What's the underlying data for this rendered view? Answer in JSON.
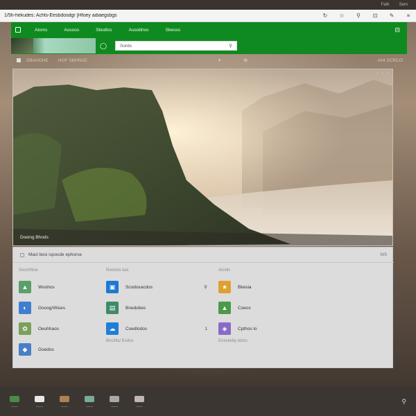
{
  "system": {
    "top_strip_items": [
      "Fath",
      "Sem"
    ]
  },
  "browser": {
    "url": "1/5h-hekudes: Achls-Eesbdosdgr [Hfoey adiaegsbgs",
    "tools": [
      "↻",
      "☆",
      "⚲",
      "⊡",
      "✎",
      "≡"
    ]
  },
  "store": {
    "nav": [
      "Atoms",
      "Ausoos",
      "Sbodlos",
      "Ausobhos",
      "Sbeoss"
    ],
    "search_placeholder": "Sords",
    "search_icon": "search-icon",
    "accent": "#0f8a20"
  },
  "sub_toolbar": {
    "left_text": "SBAHOHE",
    "left_text_2": "HOF SBHRAE",
    "right_text": "AHI SCRCO"
  },
  "hero": {
    "caption": "Doeing Bhods",
    "controls": [
      "◦",
      "◦",
      "◦"
    ]
  },
  "apps_panel": {
    "title": "Macl besi ispocde ephorse",
    "right_label": "W5",
    "columns": [
      {
        "title": "Sxochhise",
        "rows": [
          {
            "label": "Woohos",
            "icon_color": "#5aa06a",
            "mark": ""
          },
          {
            "label": "Gooog/Wises",
            "icon_color": "#3f7fd0",
            "mark": ""
          },
          {
            "label": "Oeuhhaos",
            "icon_color": "#7aa05a",
            "mark": ""
          },
          {
            "label": "Goedos",
            "icon_color": "#4a7fc8",
            "mark": ""
          }
        ],
        "note": ""
      },
      {
        "title": "Rooclos kas",
        "rows": [
          {
            "label": "Scodoxacdos",
            "icon_color": "#1e78d2",
            "mark": "⚲"
          },
          {
            "label": "Bnedobes",
            "icon_color": "#3e8a6a",
            "mark": ""
          },
          {
            "label": "Coedlodos",
            "icon_color": "#1f7fd6",
            "mark": "1"
          }
        ],
        "note": "Bnc/ltis/ Endos"
      },
      {
        "title": "Aicolls",
        "rows": [
          {
            "label": "Bkesia",
            "icon_color": "#e0a030",
            "mark": ""
          },
          {
            "label": "Coeos",
            "icon_color": "#4a9a4a",
            "mark": ""
          },
          {
            "label": "Cpthos lo",
            "icon_color": "#8a6ac8",
            "mark": ""
          }
        ],
        "note": "Eneslodiy eldos"
      }
    ]
  },
  "taskbar": {
    "items": [
      {
        "icon": "map-icon",
        "color": "#4a8a4a"
      },
      {
        "icon": "flag-icon",
        "color": "#e8e8e8"
      },
      {
        "icon": "game-icon",
        "color": "#b08050"
      },
      {
        "icon": "photo-icon",
        "color": "#7aaa9a"
      },
      {
        "icon": "gallery-icon",
        "color": "#a8a8a8"
      },
      {
        "icon": "image-icon",
        "color": "#c0b8b0"
      }
    ],
    "right_icon": "⚲"
  }
}
